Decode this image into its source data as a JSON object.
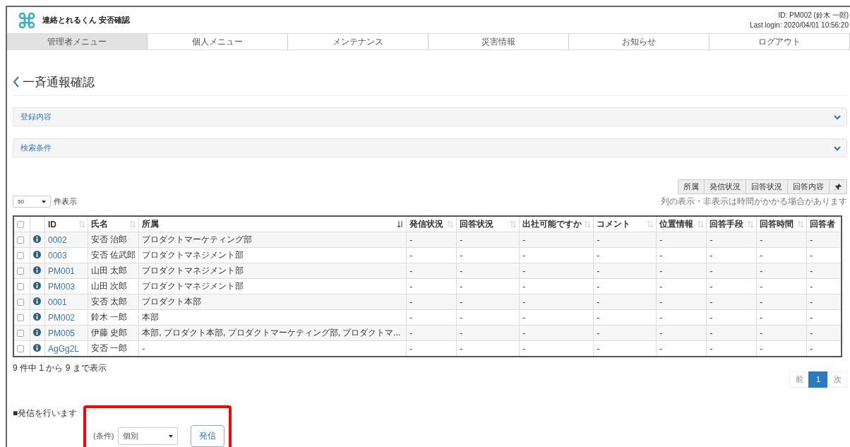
{
  "header": {
    "app_name": "連絡とれるくん 安否確認",
    "user_id": "ID: PM002 (鈴木 一郎)",
    "last_login": "Last login: 2020/04/01 10:56:20"
  },
  "nav": [
    {
      "label": "管理者メニュー",
      "selected": true
    },
    {
      "label": "個人メニュー",
      "selected": false
    },
    {
      "label": "メンテナンス",
      "selected": false
    },
    {
      "label": "災害情報",
      "selected": false
    },
    {
      "label": "お知らせ",
      "selected": false
    },
    {
      "label": "ログアウト",
      "selected": false
    }
  ],
  "page_title": "一斉通報確認",
  "panels": [
    {
      "title": "登録内容",
      "expanded": false
    },
    {
      "title": "検索条件",
      "expanded": false
    }
  ],
  "column_toggles": [
    {
      "label": "所属",
      "kind": "text"
    },
    {
      "label": "発信状況",
      "kind": "text"
    },
    {
      "label": "回答状況",
      "kind": "text"
    },
    {
      "label": "回答内容",
      "kind": "text"
    },
    {
      "kind": "pin"
    }
  ],
  "column_note": "列の表示・非表示は時間がかかる場合があります",
  "page_length": {
    "value": "50",
    "label": "件表示"
  },
  "table": {
    "select_all": {
      "checked": false
    },
    "columns": [
      {
        "label": "ID",
        "kind": "sortable",
        "sorted": false
      },
      {
        "label": "氏名",
        "kind": "sortable",
        "sorted": false
      },
      {
        "label": "所属",
        "kind": "sortable",
        "sorted": true
      },
      {
        "label": "発信状況",
        "kind": "sortable",
        "sorted": false
      },
      {
        "label": "回答状況",
        "kind": "sortable",
        "sorted": false
      },
      {
        "label": "出社可能ですか",
        "kind": "sortable",
        "sorted": false
      },
      {
        "label": "コメント",
        "kind": "sortable",
        "sorted": false
      },
      {
        "label": "位置情報",
        "kind": "sortable",
        "sorted": false
      },
      {
        "label": "回答手段",
        "kind": "sortable",
        "sorted": false
      },
      {
        "label": "回答時間",
        "kind": "sortable",
        "sorted": false
      },
      {
        "label": "回答者",
        "kind": "plain"
      }
    ],
    "rows": [
      {
        "checked": false,
        "cells": [
          "0002",
          "安否 治郎",
          "プロダクトマーケティング部",
          "-",
          "-",
          "-",
          "-",
          "-",
          "-",
          "-",
          "-"
        ]
      },
      {
        "checked": false,
        "cells": [
          "0003",
          "安否 佐武郎",
          "プロダクトマネジメント部",
          "-",
          "-",
          "-",
          "-",
          "-",
          "-",
          "-",
          "-"
        ]
      },
      {
        "checked": false,
        "cells": [
          "PM001",
          "山田 太郎",
          "プロダクトマネジメント部",
          "-",
          "-",
          "-",
          "-",
          "-",
          "-",
          "-",
          "-"
        ]
      },
      {
        "checked": false,
        "cells": [
          "PM003",
          "山田 次郎",
          "プロダクトマネジメント部",
          "-",
          "-",
          "-",
          "-",
          "-",
          "-",
          "-",
          "-"
        ]
      },
      {
        "checked": false,
        "cells": [
          "0001",
          "安否 太郎",
          "プロダクト本部",
          "-",
          "-",
          "-",
          "-",
          "-",
          "-",
          "-",
          "-"
        ]
      },
      {
        "checked": false,
        "cells": [
          "PM002",
          "鈴木 一郎",
          "本部",
          "-",
          "-",
          "-",
          "-",
          "-",
          "-",
          "-",
          "-"
        ]
      },
      {
        "checked": false,
        "cells": [
          "PM005",
          "伊藤 史郎",
          "本部, プロダクト本部, プロダクトマーケティング部, プロダクトマ...",
          "-",
          "-",
          "-",
          "-",
          "-",
          "-",
          "-",
          "-"
        ]
      },
      {
        "checked": false,
        "cells": [
          "AgGg2L",
          "安否 一郎",
          "-",
          "-",
          "-",
          "-",
          "-",
          "-",
          "-",
          "-",
          "-"
        ]
      }
    ]
  },
  "table_info": "9 件中 1 から 9 まで表示",
  "pagination": [
    {
      "label": "前",
      "selected": false
    },
    {
      "label": "1",
      "selected": true
    },
    {
      "label": "次",
      "selected": false
    }
  ],
  "send_section": {
    "heading": "■発信を行います",
    "highlighted": true,
    "condition_label": "(条件)",
    "condition_value": "個別",
    "send_button": "発信"
  }
}
